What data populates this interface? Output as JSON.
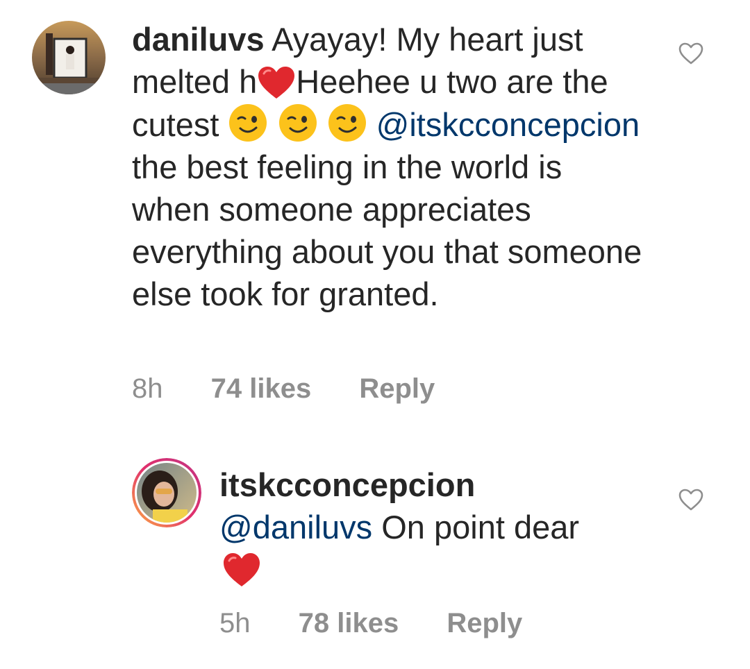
{
  "comments": [
    {
      "username": "daniluvs",
      "segments": {
        "t1": " Ayayay! My heart just melted h",
        "t2": "Heehee u two are the cutest ",
        "mention": "@itskcconcepcion",
        "t3": " the best feeling in the world is when someone appreciates everything about you that someone else took for granted."
      },
      "time": "8h",
      "likes": "74 likes",
      "reply_label": "Reply",
      "icons": [
        "red-heart-emoji",
        "winking-face-emoji",
        "heart-outline-icon"
      ]
    },
    {
      "username": "itskcconcepcion",
      "segments": {
        "mention": "@daniluvs",
        "t1": " On point dear"
      },
      "time": "5h",
      "likes": "78 likes",
      "reply_label": "Reply",
      "icons": [
        "red-heart-emoji",
        "heart-outline-icon"
      ]
    }
  ],
  "colors": {
    "text": "#262626",
    "mention": "#00376b",
    "meta": "#8e8e8e",
    "heart_emoji": "#e0282e",
    "story_ring": "#d6249f"
  }
}
